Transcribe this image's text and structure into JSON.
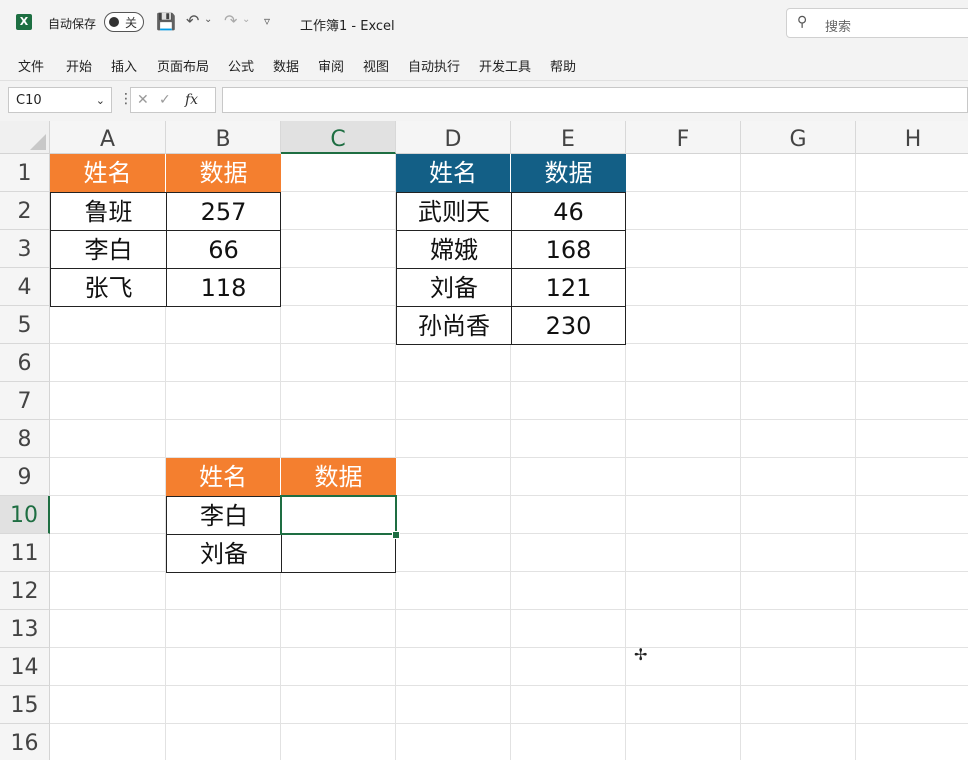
{
  "titlebar": {
    "app_icon": "X",
    "autosave_label": "自动保存",
    "autosave_state": "关",
    "doc_title": "工作簿1  -  Excel",
    "search_placeholder": "搜索",
    "icons": [
      "excel-logo-icon",
      "save-icon",
      "undo-icon",
      "redo-icon",
      "customize-qat-icon",
      "search-icon"
    ]
  },
  "menu": [
    "文件",
    "开始",
    "插入",
    "页面布局",
    "公式",
    "数据",
    "审阅",
    "视图",
    "自动执行",
    "开发工具",
    "帮助"
  ],
  "formula_bar": {
    "name_box": "C10",
    "formula": "",
    "fx_label": "fx"
  },
  "columns": [
    "A",
    "B",
    "C",
    "D",
    "E",
    "F",
    "G",
    "H"
  ],
  "rows": [
    "1",
    "2",
    "3",
    "4",
    "5",
    "6",
    "7",
    "8",
    "9",
    "10",
    "11",
    "12",
    "13",
    "14",
    "15",
    "16"
  ],
  "selected_cell": {
    "col": "C",
    "row": "10"
  },
  "table1": {
    "headers": [
      "姓名",
      "数据"
    ],
    "rows": [
      [
        "鲁班",
        "257"
      ],
      [
        "李白",
        "66"
      ],
      [
        "张飞",
        "118"
      ]
    ]
  },
  "table2": {
    "headers": [
      "姓名",
      "数据"
    ],
    "rows": [
      [
        "武则天",
        "46"
      ],
      [
        "嫦娥",
        "168"
      ],
      [
        "刘备",
        "121"
      ],
      [
        "孙尚香",
        "230"
      ]
    ]
  },
  "table3": {
    "headers": [
      "姓名",
      "数据"
    ],
    "rows": [
      [
        "李白",
        ""
      ],
      [
        "刘备",
        ""
      ]
    ]
  },
  "colors": {
    "header_orange": "#f47f2f",
    "header_blue": "#135f86",
    "excel_green": "#1e6e42"
  }
}
